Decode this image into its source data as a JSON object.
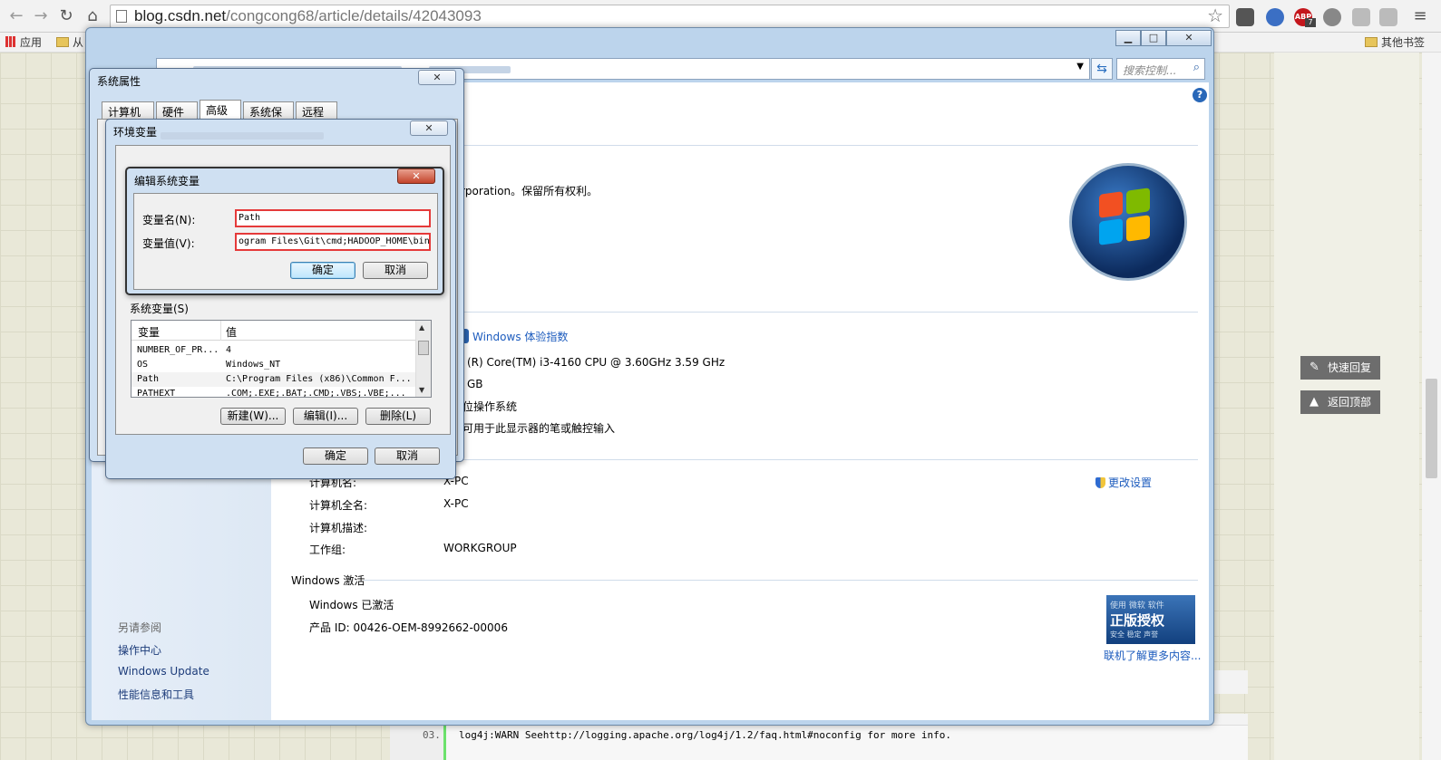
{
  "browser": {
    "url_host": "blog.csdn.net",
    "url_path": "/congcong68/article/details/42043093",
    "bookmarks": {
      "apps": "应用",
      "first": "从",
      "other": "其他书签"
    },
    "extensions": {
      "abp": "ABP",
      "abp_badge": "7"
    }
  },
  "blog": {
    "quick_reply": "快速回复",
    "back_to_top": "返回顶部",
    "code_line_no": "03.",
    "code_line": "log4j:WARN Seehttp://logging.apache.org/log4j/1.2/faq.html#noconfig for more info."
  },
  "control_panel": {
    "search_placeholder": "搜索控制...",
    "copyright": "rporation。保留所有权利。",
    "wei_link": "Windows 体验指数",
    "cpu": "(R) Core(TM) i3-4160 CPU @ 3.60GHz   3.59 GHz",
    "ram_suffix": "GB",
    "os_type": "位操作系统",
    "pen_touch": "可用于此显示器的笔或触控输入",
    "computer_name_label": "计算机名:",
    "computer_name": "X-PC",
    "full_name_label": "计算机全名:",
    "full_name": "X-PC",
    "description_label": "计算机描述:",
    "workgroup_label": "工作组:",
    "workgroup": "WORKGROUP",
    "change_settings": "更改设置",
    "activation_heading": "Windows 激活",
    "activated": "Windows 已激活",
    "product_id": "产品 ID: 00426-OEM-8992662-00006",
    "genuine_top": "使用 微软 软件",
    "genuine_main": "正版授权",
    "genuine_bottom": "安全 稳定 声誉",
    "learn_more": "联机了解更多内容...",
    "see_also": "另请参阅",
    "links": [
      "操作中心",
      "Windows Update",
      "性能信息和工具"
    ]
  },
  "sys_props": {
    "title": "系统属性",
    "tabs": [
      "计算机名",
      "硬件",
      "高级",
      "系统保护",
      "远程"
    ]
  },
  "env_vars": {
    "title": "环境变量",
    "system_vars_label": "系统变量(S)",
    "col_var": "变量",
    "col_val": "值",
    "rows": [
      {
        "name": "NUMBER_OF_PR...",
        "value": "4"
      },
      {
        "name": "OS",
        "value": "Windows_NT"
      },
      {
        "name": "Path",
        "value": "C:\\Program Files (x86)\\Common F..."
      },
      {
        "name": "PATHEXT",
        "value": ".COM;.EXE;.BAT;.CMD;.VBS;.VBE;..."
      }
    ],
    "new_btn": "新建(W)...",
    "edit_btn": "编辑(I)...",
    "delete_btn": "删除(L)",
    "ok": "确定",
    "cancel": "取消"
  },
  "edit_var": {
    "title": "编辑系统变量",
    "name_label": "变量名(N):",
    "name_value": "Path",
    "value_label": "变量值(V):",
    "value_value": "ogram Files\\Git\\cmd;HADOOP_HOME\\bin",
    "ok": "确定",
    "cancel": "取消"
  }
}
